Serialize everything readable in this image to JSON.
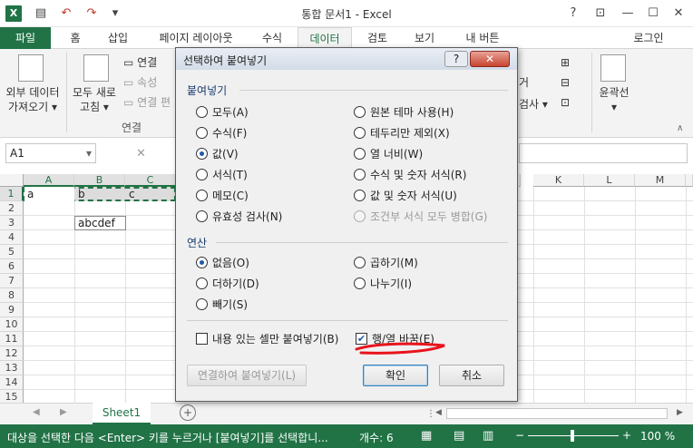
{
  "window": {
    "title": "통합 문서1 - Excel",
    "help": "?",
    "controls": [
      "⊡",
      "—",
      "☐",
      "✕"
    ]
  },
  "qat": {
    "undo": "↶",
    "redo": "↷"
  },
  "ribbon_tabs": [
    "파일",
    "홈",
    "삽입",
    "페이지 레이아웃",
    "수식",
    "데이터",
    "검토",
    "보기",
    "내 버튼"
  ],
  "account": "로그인",
  "ribbon": {
    "get_external": [
      "외부 데이터",
      "가져오기 ▾"
    ],
    "refresh_all": [
      "모두 새로",
      "고침 ▾"
    ],
    "connections": "연결",
    "properties": "속성",
    "edit_links": "연결 편",
    "connections_group": "연결",
    "outline": "윤곽선",
    "right_partial_1": "거",
    "right_partial_2": "검사 ▾"
  },
  "formula_bar": {
    "name_box": "A1",
    "fx_x": "✕"
  },
  "columns": [
    "A",
    "B",
    "C",
    "K",
    "L",
    "M"
  ],
  "rows": [
    "1",
    "2",
    "3",
    "4",
    "5",
    "6",
    "7",
    "8",
    "9",
    "10",
    "11",
    "12",
    "13",
    "14",
    "15"
  ],
  "cells": {
    "a1": "a",
    "b1": "b",
    "c1": "c",
    "b3": "abcdef"
  },
  "sheet_tab": "Sheet1",
  "status": {
    "message": "대상을 선택한 다음 <Enter> 키를 누르거나 [붙여넣기]를 선택합니...",
    "count": "개수: 6",
    "zoom": "100 %"
  },
  "dialog": {
    "title": "선택하여 붙여넣기",
    "help_btn": "?",
    "paste_section": "붙여넣기",
    "paste_left": [
      "모두(A)",
      "수식(F)",
      "값(V)",
      "서식(T)",
      "메모(C)",
      "유효성 검사(N)"
    ],
    "paste_right": [
      "원본 테마 사용(H)",
      "테두리만 제외(X)",
      "열 너비(W)",
      "수식 및 숫자 서식(R)",
      "값 및 숫자 서식(U)",
      "조건부 서식 모두 병합(G)"
    ],
    "operation_section": "연산",
    "op_left": [
      "없음(O)",
      "더하기(D)",
      "빼기(S)"
    ],
    "op_right": [
      "곱하기(M)",
      "나누기(I)"
    ],
    "skip_blanks": "내용 있는 셀만 붙여넣기(B)",
    "transpose": "행/열 바꿈(E)",
    "paste_link": "연결하여 붙여넣기(L)",
    "ok": "확인",
    "cancel": "취소",
    "selected_paste": "값(V)",
    "selected_op": "없음(O)",
    "transpose_checked": true
  },
  "colors": {
    "excel_green": "#217346",
    "annotation_red": "#e8141c"
  }
}
